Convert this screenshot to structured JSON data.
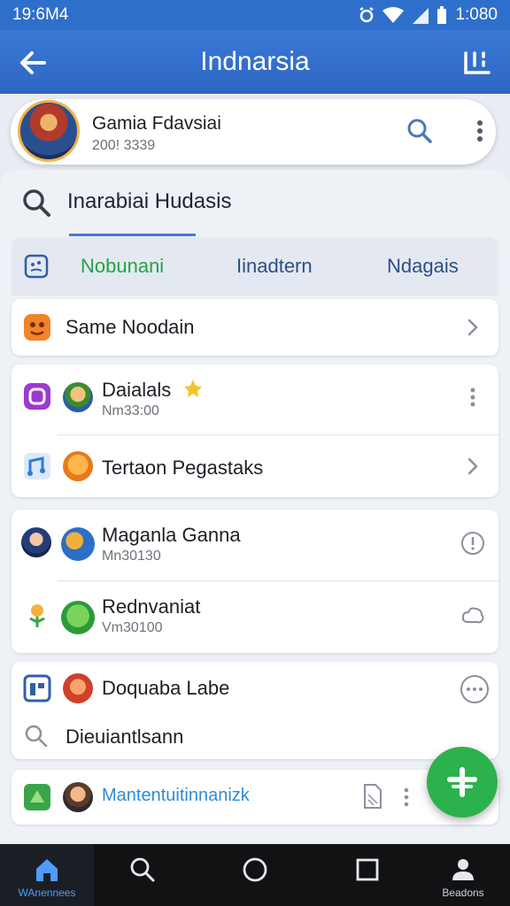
{
  "status": {
    "time": "19:6M4",
    "clock": "1:080"
  },
  "appbar": {
    "title": "Indnarsia"
  },
  "header": {
    "name": "Gamia Fdavsiai",
    "sub": "200! 3339"
  },
  "search": {
    "text": "Inarabiai Hudasis"
  },
  "tabs": [
    "Nobunani",
    "Iinadtern",
    "Ndagais"
  ],
  "list": [
    {
      "title": "Same Noodain"
    },
    {
      "title": "Daialals",
      "sub": "Nm33:00"
    },
    {
      "title": "Tertaon Pegastaks"
    },
    {
      "title": "Maganla Ganna",
      "sub": "Mn30130"
    },
    {
      "title": "Rednvaniat",
      "sub": "Vm30100"
    },
    {
      "title": "Doquaba Labe"
    },
    {
      "title": "Dieuiantlsann"
    },
    {
      "title": "Mantentuitinnanizk"
    }
  ],
  "nav": {
    "home_label": "WAnennees",
    "profile_label": "Beadons"
  },
  "colors": {
    "primary": "#3b78d6",
    "accent_green": "#2bb24c",
    "link_blue": "#2f8bd8"
  }
}
